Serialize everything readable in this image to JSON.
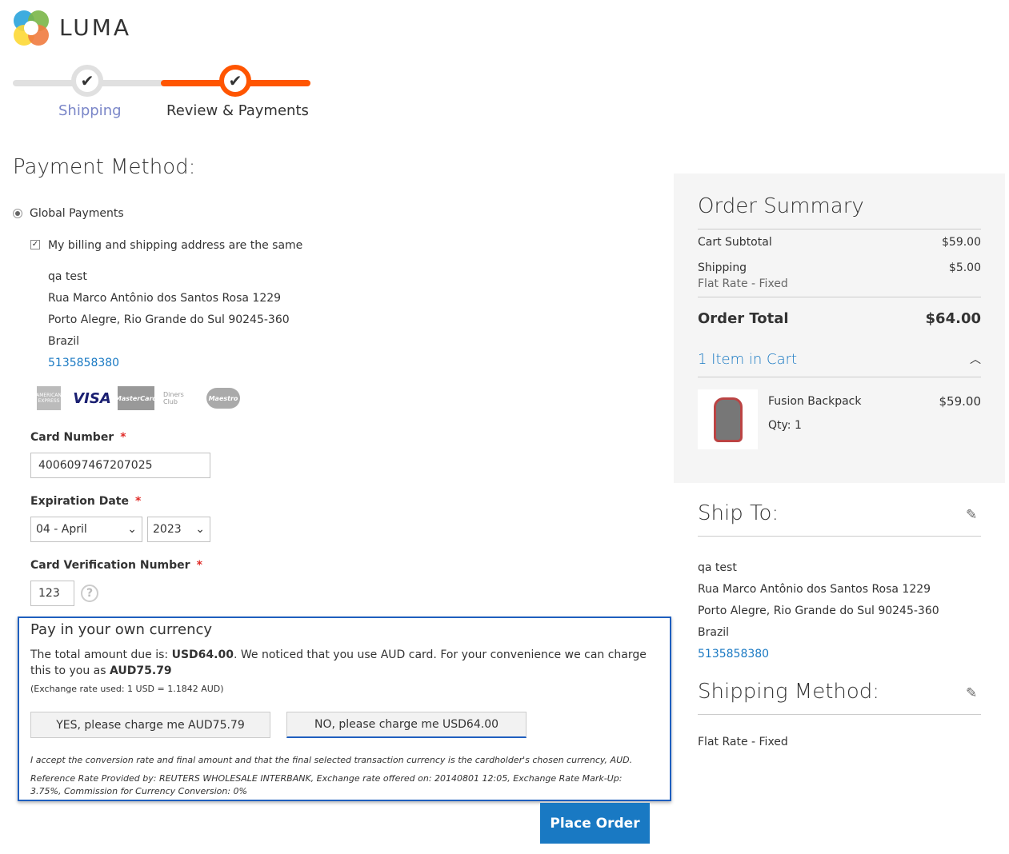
{
  "brand": {
    "name": "LUMA"
  },
  "progress": {
    "steps": [
      {
        "label": "Shipping",
        "state": "complete"
      },
      {
        "label": "Review & Payments",
        "state": "active"
      }
    ],
    "accent": "#ff5501"
  },
  "payment": {
    "title": "Payment Method:",
    "method": "Global Payments",
    "same_address_label": "My billing and shipping address are the same",
    "same_address_checked": true,
    "address": {
      "name": "qa test",
      "street": "Rua Marco Antônio dos Santos Rosa 1229",
      "city": "Porto Alegre, Rio Grande do Sul 90245-360",
      "country": "Brazil",
      "phone": "5135858380"
    },
    "cards": [
      "American Express",
      "VISA",
      "MasterCard",
      "Diners Club",
      "Maestro"
    ],
    "card_number_label": "Card Number",
    "card_number": "4006097467207025",
    "exp_label": "Expiration Date",
    "exp_month": "04 - April",
    "exp_year": "2023",
    "cvv_label": "Card Verification Number",
    "cvv": "123",
    "required": "*",
    "help": "?"
  },
  "dcc": {
    "title": "Pay in your own currency",
    "text1": "The total amount due is: ",
    "amount_usd": "USD64.00",
    "text2": ". We noticed that you use AUD card. For your convenience we can charge this to you as ",
    "amount_aud": "AUD75.79",
    "rate": "(Exchange rate used: 1 USD = 1.1842 AUD)",
    "yes": "YES, please charge me AUD75.79",
    "no": "NO, please charge me USD64.00",
    "accept": "I accept the conversion rate and final amount and that the final selected transaction currency is the cardholder's chosen currency, AUD.",
    "reference": "Reference Rate Provided by: REUTERS WHOLESALE INTERBANK, Exchange rate offered on: 20140801 12:05, Exchange Rate Mark-Up: 3.75%, Commission for Currency Conversion: 0%"
  },
  "place_order": "Place Order",
  "summary": {
    "title": "Order Summary",
    "subtotal_label": "Cart Subtotal",
    "subtotal": "$59.00",
    "shipping_label": "Shipping",
    "shipping_method": "Flat Rate - Fixed",
    "shipping": "$5.00",
    "total_label": "Order Total",
    "total": "$64.00",
    "items_label": "1 Item in Cart",
    "item": {
      "name": "Fusion Backpack",
      "price": "$59.00",
      "qty": "Qty: 1"
    }
  },
  "ship_to": {
    "title": "Ship To:",
    "name": "qa test",
    "street": "Rua Marco Antônio dos Santos Rosa 1229",
    "city": "Porto Alegre, Rio Grande do Sul 90245-360",
    "country": "Brazil",
    "phone": "5135858380"
  },
  "ship_method": {
    "title": "Shipping Method:",
    "value": "Flat Rate - Fixed"
  }
}
